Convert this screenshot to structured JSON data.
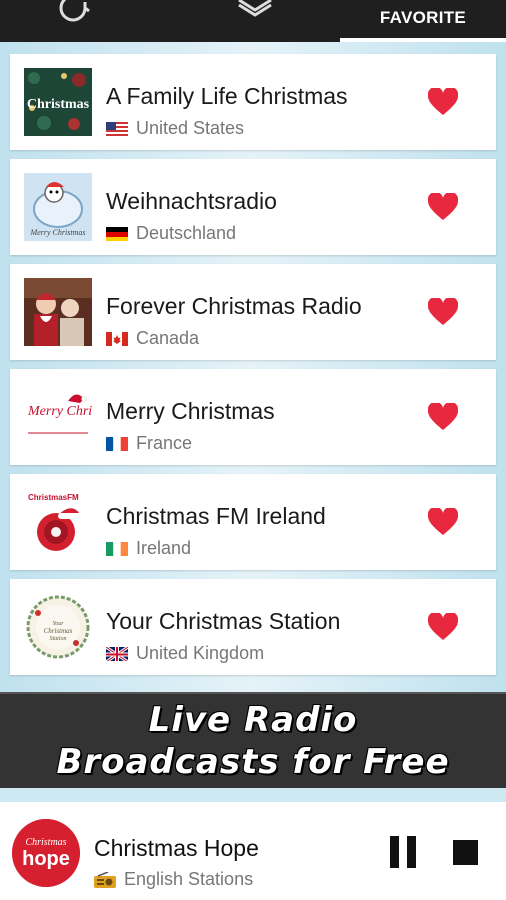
{
  "tabs": {
    "history_icon": "history-icon",
    "layers_icon": "layers-icon",
    "favorite_label": "FAVORITE"
  },
  "stations": [
    {
      "name": "A Family Life Christmas",
      "country": "United States",
      "flag": "us-flag",
      "logo_text": "Christmas"
    },
    {
      "name": "Weihnachtsradio",
      "country": "Deutschland",
      "flag": "de-flag",
      "logo_text": "Merry Christmas"
    },
    {
      "name": "Forever Christmas Radio",
      "country": "Canada",
      "flag": "ca-flag",
      "logo_text": ""
    },
    {
      "name": "Merry Christmas",
      "country": "France",
      "flag": "fr-flag",
      "logo_text": "Merry Christmas"
    },
    {
      "name": "Christmas FM Ireland",
      "country": "Ireland",
      "flag": "ie-flag",
      "logo_text": "ChristmasFM"
    },
    {
      "name": "Your Christmas Station",
      "country": "United Kingdom",
      "flag": "uk-flag",
      "logo_text": "Your Christmas Station"
    }
  ],
  "banner": {
    "line1": "Live Radio",
    "line2": "Broadcasts for Free"
  },
  "player": {
    "title": "Christmas Hope",
    "subtitle": "English Stations",
    "logo_text_top": "Christmas",
    "logo_text_main": "hope"
  },
  "colors": {
    "topbar": "#1f1f1f",
    "heart": "#e8283e",
    "background": "#cfe9f3",
    "banner": "#333333"
  }
}
